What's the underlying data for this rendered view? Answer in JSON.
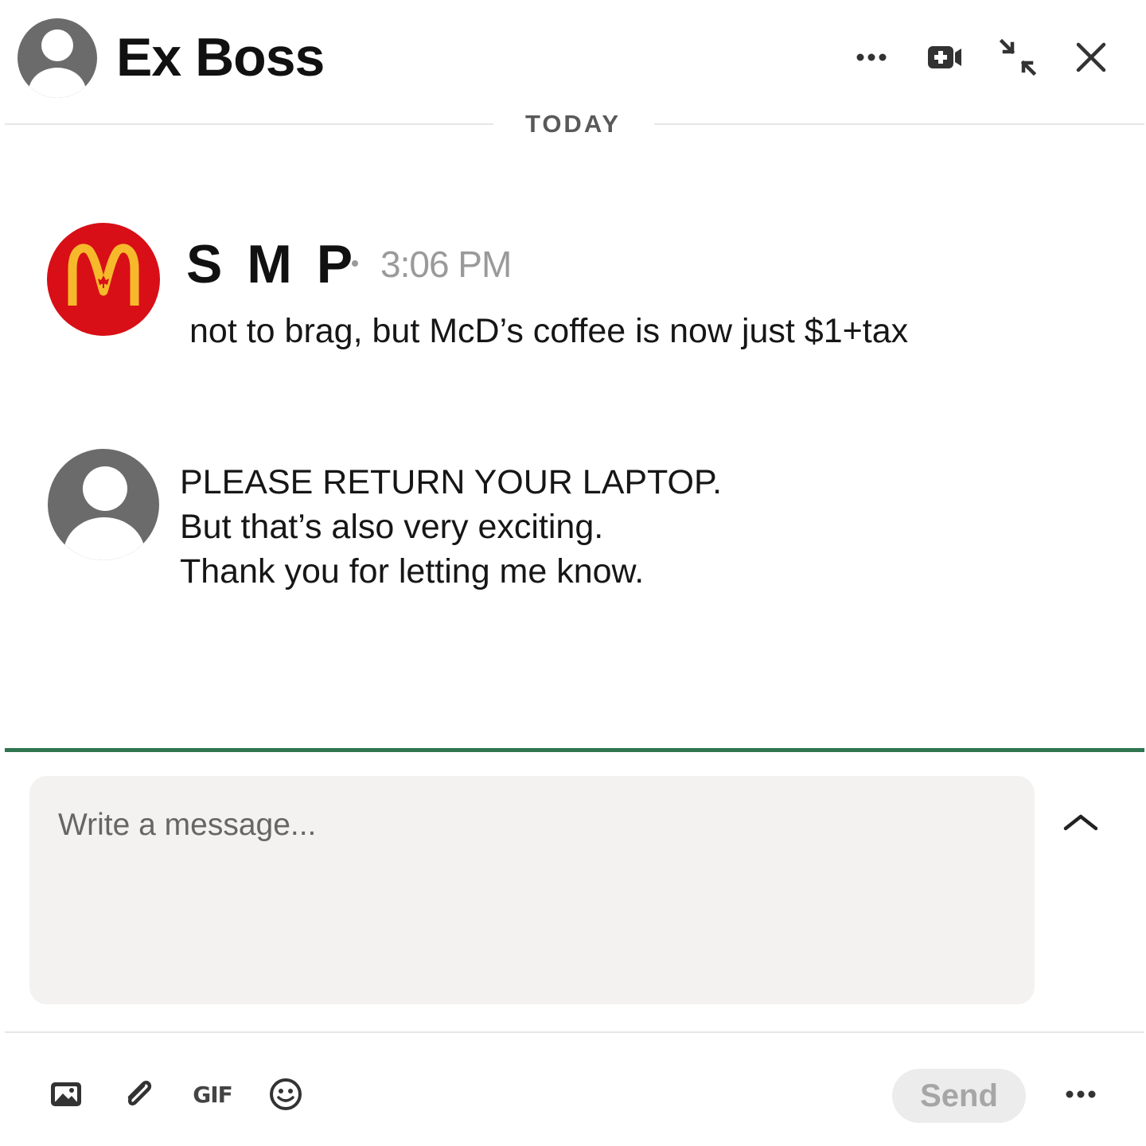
{
  "header": {
    "title": "Ex Boss",
    "actions": [
      {
        "name": "more-options",
        "icon": "ellipsis-icon"
      },
      {
        "name": "video-call",
        "icon": "video-plus-icon"
      },
      {
        "name": "minimize",
        "icon": "collapse-arrows-icon"
      },
      {
        "name": "close",
        "icon": "close-icon"
      }
    ]
  },
  "divider": {
    "label": "TODAY"
  },
  "messages": [
    {
      "sender": "S M P",
      "time": "3:06 PM",
      "avatar_icon": "mcdonalds-logo-icon",
      "lines": [
        "not to brag, but McD’s coffee is now just $1+tax"
      ]
    },
    {
      "avatar_icon": "user-avatar-icon",
      "lines": [
        "PLEASE RETURN YOUR LAPTOP.",
        "But that’s also very exciting.",
        "Thank you for letting me know."
      ]
    }
  ],
  "composer": {
    "placeholder": "Write a message...",
    "send_label": "Send",
    "tools": [
      "image-icon",
      "paperclip-icon",
      "gif-icon",
      "emoji-icon"
    ],
    "gif_label": "GIF"
  },
  "colors": {
    "accent": "#2e7550",
    "mcd_red": "#d80f16",
    "mcd_gold": "#f6b92b",
    "avatar_gray": "#6b6b6b"
  }
}
